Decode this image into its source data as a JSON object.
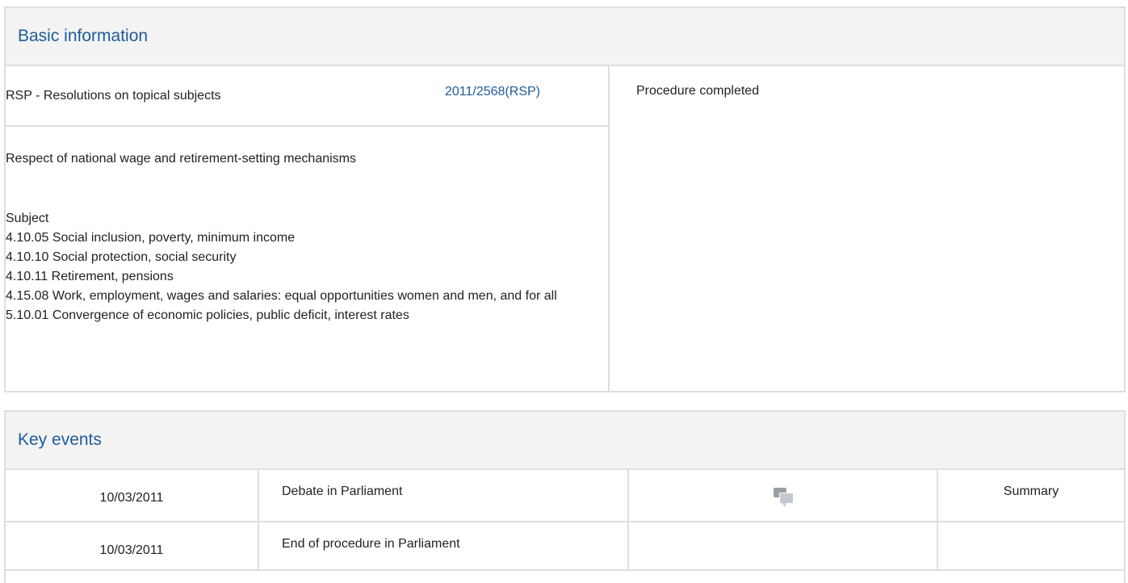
{
  "basic": {
    "header": "Basic information",
    "procedure_type": "RSP - Resolutions on topical subjects",
    "reference": "2011/2568(RSP)",
    "status": "Procedure completed",
    "title": "Respect of national wage and retirement-setting mechanisms",
    "subject_label": "Subject",
    "subjects": [
      "4.10.05 Social inclusion, poverty, minimum income",
      "4.10.10 Social protection, social security",
      "4.10.11 Retirement, pensions",
      "4.15.08 Work, employment, wages and salaries: equal opportunities women and men, and for all",
      "5.10.01 Convergence of economic policies, public deficit, interest rates"
    ]
  },
  "events": {
    "header": "Key events",
    "rows": [
      {
        "date": "10/03/2011",
        "event": "Debate in Parliament",
        "icon": "debate-icon",
        "summary": "Summary"
      },
      {
        "date": "10/03/2011",
        "event": "End of procedure in Parliament",
        "icon": "",
        "summary": ""
      }
    ]
  }
}
